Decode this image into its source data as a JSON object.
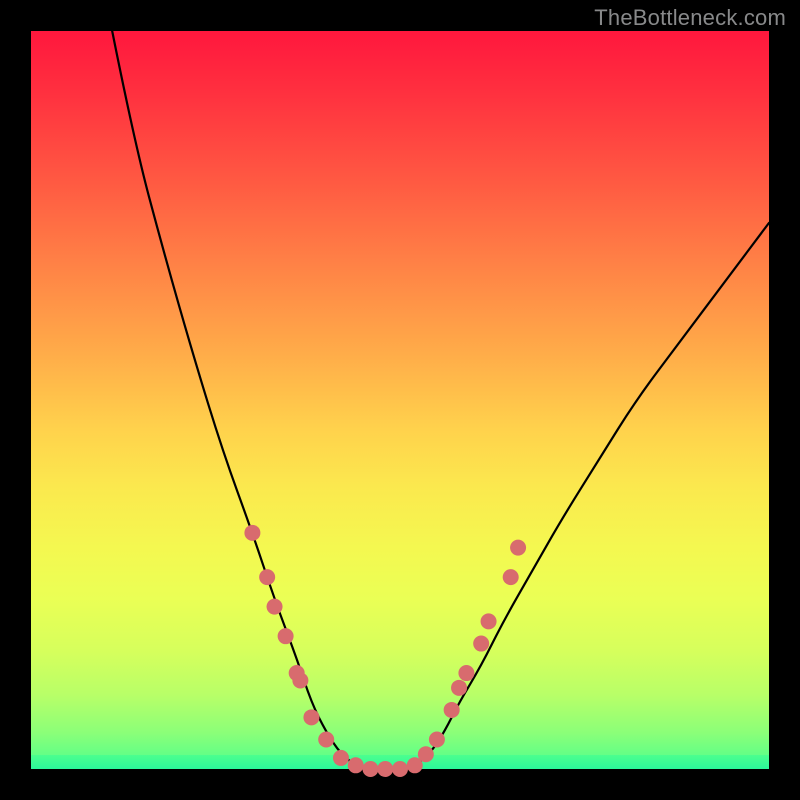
{
  "watermark": "TheBottleneck.com",
  "colors": {
    "background_frame": "#000000",
    "gradient_top": "#ff173d",
    "gradient_mid": "#ffd24c",
    "gradient_bottom": "#4cff8e",
    "curve_stroke": "#000000",
    "marker_fill": "#d86b6e"
  },
  "chart_data": {
    "type": "line",
    "title": "",
    "xlabel": "",
    "ylabel": "",
    "xlim": [
      0,
      100
    ],
    "ylim": [
      0,
      100
    ],
    "note": "Two black curves descending from the top edges into a valley near x≈42–50 where y≈0, then rising again toward the right. Pink circular markers cluster along the lower portions of both limbs and across the valley floor. Axis ticks/labels are not shown; values below are estimated from pixel positions. y=0 is the bottom (green) edge, y=100 the top (red).",
    "series": [
      {
        "name": "left-curve",
        "x": [
          11,
          14,
          18,
          22,
          26,
          30,
          33,
          36,
          38,
          40,
          42,
          44,
          46,
          48,
          50
        ],
        "y": [
          100,
          85,
          70,
          56,
          43,
          32,
          23,
          15,
          9,
          5,
          2,
          0.5,
          0,
          0,
          0
        ]
      },
      {
        "name": "right-curve",
        "x": [
          50,
          52,
          54,
          56,
          58,
          61,
          64,
          68,
          72,
          77,
          82,
          88,
          94,
          100
        ],
        "y": [
          0,
          0.5,
          2,
          5,
          9,
          14,
          20,
          27,
          34,
          42,
          50,
          58,
          66,
          74
        ]
      }
    ],
    "markers": {
      "name": "pink-markers",
      "points": [
        {
          "x": 30,
          "y": 32
        },
        {
          "x": 32,
          "y": 26
        },
        {
          "x": 33,
          "y": 22
        },
        {
          "x": 34.5,
          "y": 18
        },
        {
          "x": 36,
          "y": 13
        },
        {
          "x": 36.5,
          "y": 12
        },
        {
          "x": 38,
          "y": 7
        },
        {
          "x": 40,
          "y": 4
        },
        {
          "x": 42,
          "y": 1.5
        },
        {
          "x": 44,
          "y": 0.5
        },
        {
          "x": 46,
          "y": 0
        },
        {
          "x": 48,
          "y": 0
        },
        {
          "x": 50,
          "y": 0
        },
        {
          "x": 52,
          "y": 0.5
        },
        {
          "x": 53.5,
          "y": 2
        },
        {
          "x": 55,
          "y": 4
        },
        {
          "x": 57,
          "y": 8
        },
        {
          "x": 58,
          "y": 11
        },
        {
          "x": 59,
          "y": 13
        },
        {
          "x": 61,
          "y": 17
        },
        {
          "x": 62,
          "y": 20
        },
        {
          "x": 65,
          "y": 26
        },
        {
          "x": 66,
          "y": 30
        }
      ],
      "radius_px": 8
    }
  }
}
